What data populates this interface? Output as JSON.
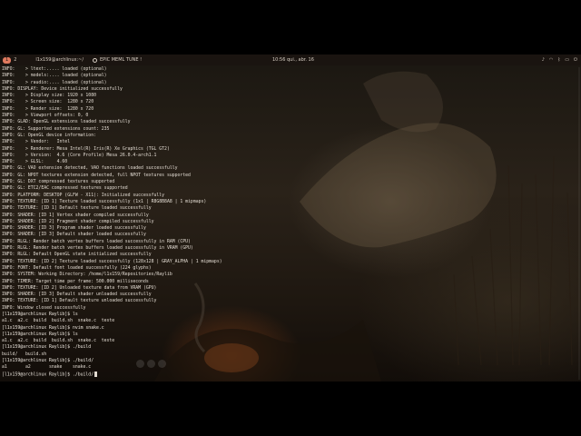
{
  "topbar": {
    "workspace_badge": "1",
    "workspace_num": "2",
    "window_title": "l1x159@archlinux:~/",
    "music_title": "EPIC MEML TUNE !",
    "clock": "10:56 qui., abr. 16",
    "tray_icons": [
      "sound-icon",
      "network-icon",
      "bluetooth-icon",
      "battery-icon",
      "power-icon"
    ]
  },
  "terminal": {
    "lines": [
      "INFO:    > ltext:..... loaded (optional)",
      "INFO:    > models:.... loaded (optional)",
      "INFO:    > raudio:.... loaded (optional)",
      "INFO: DISPLAY: Device initialized successfully",
      "INFO:    > Display size: 1920 x 1080",
      "INFO:    > Screen size:  1280 x 720",
      "INFO:    > Render size:  1280 x 720",
      "INFO:    > Viewport offsets: 0, 0",
      "INFO: GLAD: OpenGL extensions loaded successfully",
      "INFO: GL: Supported extensions count: 235",
      "INFO: GL: OpenGL device information:",
      "INFO:    > Vendor:   Intel",
      "INFO:    > Renderer: Mesa Intel(R) Iris(R) Xe Graphics (TGL GT2)",
      "INFO:    > Version:  4.6 (Core Profile) Mesa 26.0.4-arch1.1",
      "INFO:    > GLSL:     4.60",
      "INFO: GL: VAO extension detected, VAO functions loaded successfully",
      "INFO: GL: NPOT textures extension detected, full NPOT textures supported",
      "INFO: GL: DXT compressed textures supported",
      "INFO: GL: ETC2/EAC compressed textures supported",
      "INFO: PLATFORM: DESKTOP (GLFW - X11): Initialized successfully",
      "INFO: TEXTURE: [ID 1] Texture loaded successfully (1x1 | R8G8B8A8 | 1 mipmaps)",
      "INFO: TEXTURE: [ID 1] Default texture loaded successfully",
      "INFO: SHADER: [ID 1] Vertex shader compiled successfully",
      "INFO: SHADER: [ID 2] Fragment shader compiled successfully",
      "INFO: SHADER: [ID 3] Program shader loaded successfully",
      "INFO: SHADER: [ID 3] Default shader loaded successfully",
      "INFO: RLGL: Render batch vertex buffers loaded successfully in RAM (CPU)",
      "INFO: RLGL: Render batch vertex buffers loaded successfully in VRAM (GPU)",
      "INFO: RLGL: Default OpenGL state initialized successfully",
      "INFO: TEXTURE: [ID 2] Texture loaded successfully (128x128 | GRAY_ALPHA | 1 mipmaps)",
      "INFO: FONT: Default font loaded successfully (224 glyphs)",
      "INFO: SYSTEM: Working Directory: /home/l1x159/Repositories/Raylib",
      "INFO: TIMER: Target time per frame: 500.000 milliseconds",
      "INFO: TEXTURE: [ID 2] Unloaded texture data from VRAM (GPU)",
      "INFO: SHADER: [ID 3] Default shader unloaded successfully",
      "INFO: TEXTURE: [ID 1] Default texture unloaded successfully",
      "INFO: Window closed successfully",
      "[l1x159@archlinux Raylib]$ ls",
      "a1.c  a2.c  build  build.sh  snake.c  teste",
      "[l1x159@archlinux Raylib]$ nvim snake.c",
      "[l1x159@archlinux Raylib]$ ls",
      "a1.c  a2.c  build  build.sh  snake.c  teste",
      "[l1x159@archlinux Raylib]$ ./build",
      "build/   build.sh",
      "[l1x159@archlinux Raylib]$ ./build/",
      "a1       a2       snake    snake.c",
      "[l1x159@archlinux Raylib]$ ./build/"
    ]
  }
}
